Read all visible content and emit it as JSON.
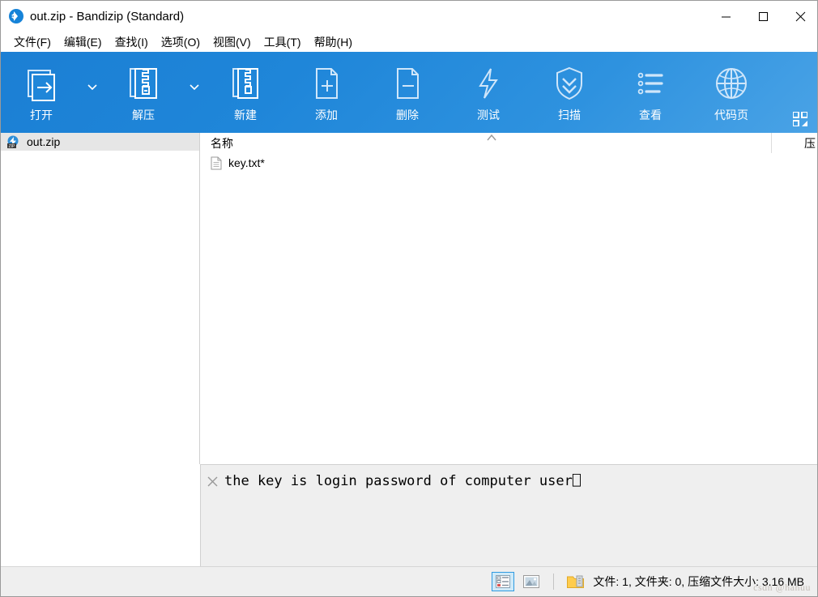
{
  "window": {
    "title": "out.zip - Bandizip (Standard)",
    "app_icon": "bandizip-logo-icon",
    "controls": {
      "minimize": "minimize-icon",
      "maximize": "maximize-icon",
      "close": "close-icon"
    }
  },
  "menubar": {
    "items": [
      {
        "label": "文件(F)"
      },
      {
        "label": "编辑(E)"
      },
      {
        "label": "查找(I)"
      },
      {
        "label": "选项(O)"
      },
      {
        "label": "视图(V)"
      },
      {
        "label": "工具(T)"
      },
      {
        "label": "帮助(H)"
      }
    ]
  },
  "toolbar": {
    "background_start": "#1b7fd4",
    "background_end": "#4aa3e6",
    "buttons": [
      {
        "label": "打开",
        "icon": "open-archive-icon",
        "dropdown": true
      },
      {
        "label": "解压",
        "icon": "extract-icon",
        "dropdown": true
      },
      {
        "label": "新建",
        "icon": "new-archive-icon",
        "dropdown": false
      },
      {
        "label": "添加",
        "icon": "add-file-icon",
        "dropdown": false
      },
      {
        "label": "删除",
        "icon": "delete-file-icon",
        "dropdown": false
      },
      {
        "label": "测试",
        "icon": "test-lightning-icon",
        "dropdown": false
      },
      {
        "label": "扫描",
        "icon": "scan-shield-icon",
        "dropdown": false
      },
      {
        "label": "查看",
        "icon": "view-list-icon",
        "dropdown": false
      },
      {
        "label": "代码页",
        "icon": "codepage-globe-icon",
        "dropdown": false
      }
    ],
    "grid_toggle_icon": "grid-layout-icon"
  },
  "sidebar": {
    "tree": [
      {
        "label": "out.zip",
        "icon": "zip-archive-icon",
        "selected": true
      }
    ]
  },
  "filelist": {
    "columns": [
      {
        "label": "名称",
        "sorted": "asc",
        "sort_icon": "caret-up-icon"
      },
      {
        "label": "压"
      }
    ],
    "rows": [
      {
        "name": "key.txt*",
        "icon": "text-document-icon"
      }
    ],
    "scrollbar": {
      "left_arrow": "chevron-left-icon",
      "right_arrow": "chevron-right-icon"
    }
  },
  "preview": {
    "close_icon": "close-preview-icon",
    "text": "the key is login password of computer user⎕"
  },
  "statusbar": {
    "view_icons": [
      {
        "name": "details-view-icon",
        "active": true
      },
      {
        "name": "thumbnail-view-icon",
        "active": false
      },
      {
        "name": "folder-icon",
        "active": false
      }
    ],
    "info": "文件: 1, 文件夹: 0, 压缩文件大小: 3.16 MB",
    "watermark": "csdn @hanuu"
  }
}
